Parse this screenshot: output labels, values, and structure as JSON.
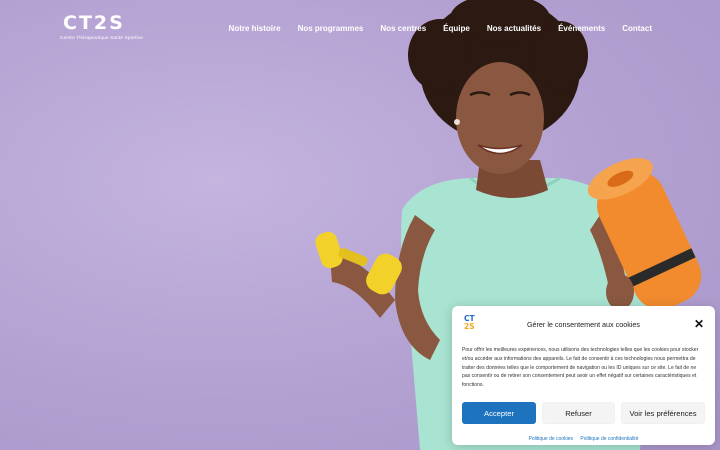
{
  "brand": {
    "logo_mark": "CT2S",
    "logo_subtitle": "Centre Thérapeutique Santé Sportive"
  },
  "nav": {
    "items": [
      {
        "label": "Notre histoire"
      },
      {
        "label": "Nos programmes"
      },
      {
        "label": "Nos centres"
      },
      {
        "label": "Équipe"
      },
      {
        "label": "Nos actualités"
      },
      {
        "label": "Événements"
      },
      {
        "label": "Contact"
      }
    ]
  },
  "hero": {
    "image_icon": "woman-with-dumbbell-and-yoga-mat-photo"
  },
  "cookie": {
    "logo_mark": [
      "CT",
      "2S"
    ],
    "title": "Gérer le consentement aux cookies",
    "close_icon": "close-icon",
    "body": "Pour offrir les meilleures expériences, nous utilisons des technologies telles que les cookies pour stocker et/ou accéder aux informations des appareils. Le fait de consentir à ces technologies nous permettra de traiter des données telles que le comportement de navigation ou les ID uniques sur ce site. Le fait de ne pas consentir ou de retirer son consentement peut avoir un effet négatif sur certaines caractéristiques et fonctions.",
    "accept_label": "Accepter",
    "refuse_label": "Refuser",
    "prefs_label": "Voir les préférences",
    "cookie_policy_label": "Politique de cookies",
    "privacy_policy_label": "Politique de confidentialité"
  },
  "colors": {
    "background": "#b9a8d6",
    "accent": "#1e73be",
    "shirt": "#a9e3d2",
    "dumbbell": "#f2d12b",
    "yoga_mat": "#f28b2e"
  }
}
